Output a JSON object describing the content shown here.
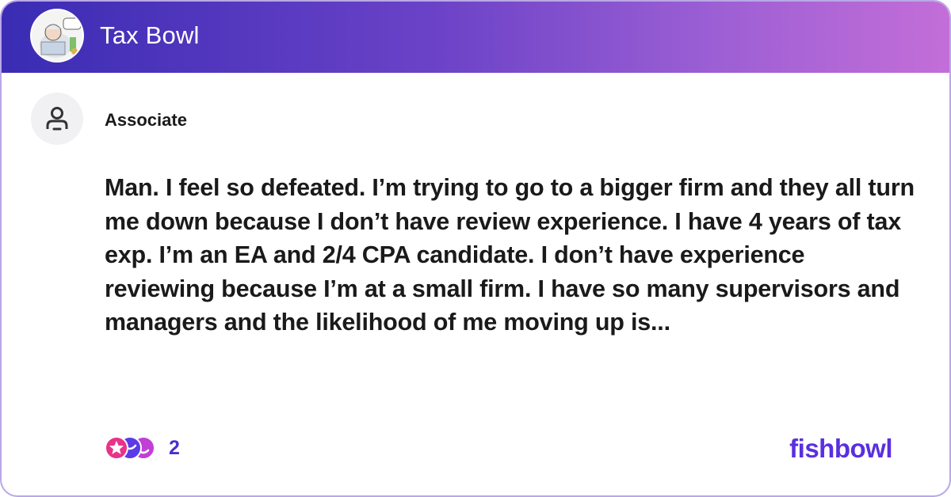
{
  "header": {
    "bowl_name": "Tax Bowl",
    "avatar_icon": "bowl-avatar-illustration"
  },
  "post": {
    "author_role": "Associate",
    "author_icon": "person-icon",
    "body": "Man. I feel so defeated. I’m trying to go to a bigger firm and they all turn me down because I don’t have review experience. I have 4 years of tax exp. I’m an EA and 2/4 CPA candidate. I don’t have experience reviewing because I’m at a small firm. I have so many supervisors and managers and the likelihood of me moving up is...",
    "reaction_count": "2",
    "reaction_icons": [
      "star-reaction-icon",
      "hug-reaction-icon",
      "laugh-reaction-icon"
    ]
  },
  "footer": {
    "brand": "fishbowl"
  },
  "colors": {
    "header_gradient_start": "#3a2cb4",
    "header_gradient_end": "#c46ed8",
    "brand": "#5a2fe0",
    "text": "#1a1a1a"
  }
}
